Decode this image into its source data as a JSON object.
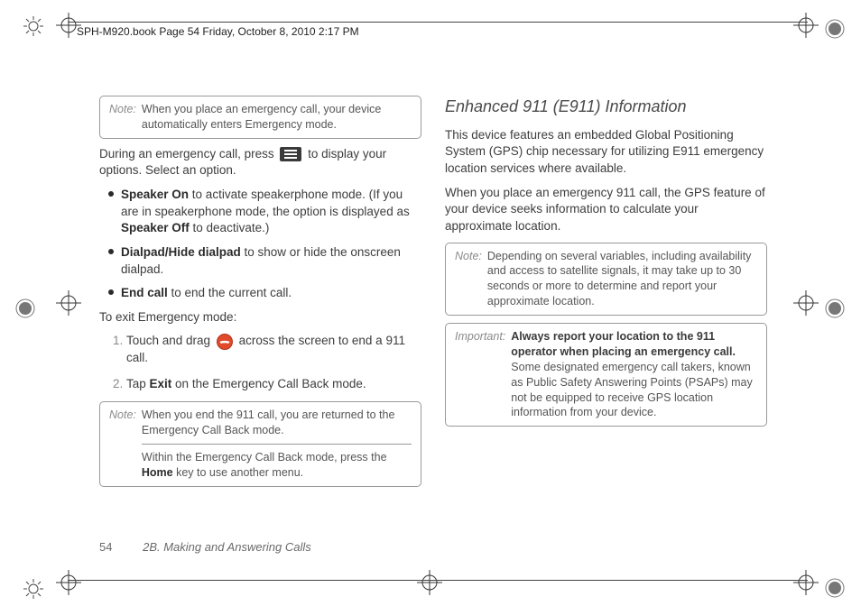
{
  "runhead": "SPH-M920.book  Page 54  Friday, October 8, 2010  2:17 PM",
  "left_col": {
    "note1": {
      "label": "Note:",
      "text": "When you place an emergency call, your device automatically enters Emergency mode."
    },
    "para_intro_a": "During an emergency call, press",
    "para_intro_b": "to display your options. Select an option.",
    "bullets": [
      {
        "bold": "Speaker On",
        "text": " to activate speakerphone mode. (If you are in speakerphone mode, the option is displayed as ",
        "bold2": "Speaker Off",
        "tail": " to deactivate.)"
      },
      {
        "bold": "Dialpad/Hide dialpad",
        "text": " to show or hide the onscreen dialpad."
      },
      {
        "bold": "End call",
        "text": " to end the current call."
      }
    ],
    "exit_heading": "To exit Emergency mode:",
    "steps": [
      {
        "pre": "Touch and drag ",
        "post": " across the screen to end a 911 call."
      },
      {
        "pre": "Tap ",
        "bold": "Exit",
        "post": " on the Emergency Call Back mode."
      }
    ],
    "note2": {
      "label": "Note:",
      "text_a": "When you end the 911 call, you are returned to the Emergency Call Back mode.",
      "text_b_pre": "Within the Emergency Call Back mode, press the ",
      "text_b_bold": "Home",
      "text_b_post": " key to use another menu."
    }
  },
  "right_col": {
    "heading": "Enhanced 911 (E911) Information",
    "p1": "This device features an embedded Global Positioning System (GPS) chip necessary for utilizing E911 emergency location services where available.",
    "p2": "When you place an emergency 911 call, the GPS feature of your device seeks information to calculate your approximate location.",
    "note": {
      "label": "Note:",
      "text": "Depending on several variables, including availability and access to satellite signals, it may take up to 30 seconds or more to determine and report your approximate location."
    },
    "important": {
      "label": "Important:",
      "lead": "Always report your location to the 911 operator when placing an emergency call.",
      "rest": " Some designated emergency call takers, known as Public Safety Answering Points (PSAPs) may not be equipped to receive GPS location information from your device."
    }
  },
  "footer": {
    "page_number": "54",
    "section": "2B. Making and Answering Calls"
  },
  "icons": {
    "menu": "menu-icon",
    "endcall": "endcall-icon"
  }
}
